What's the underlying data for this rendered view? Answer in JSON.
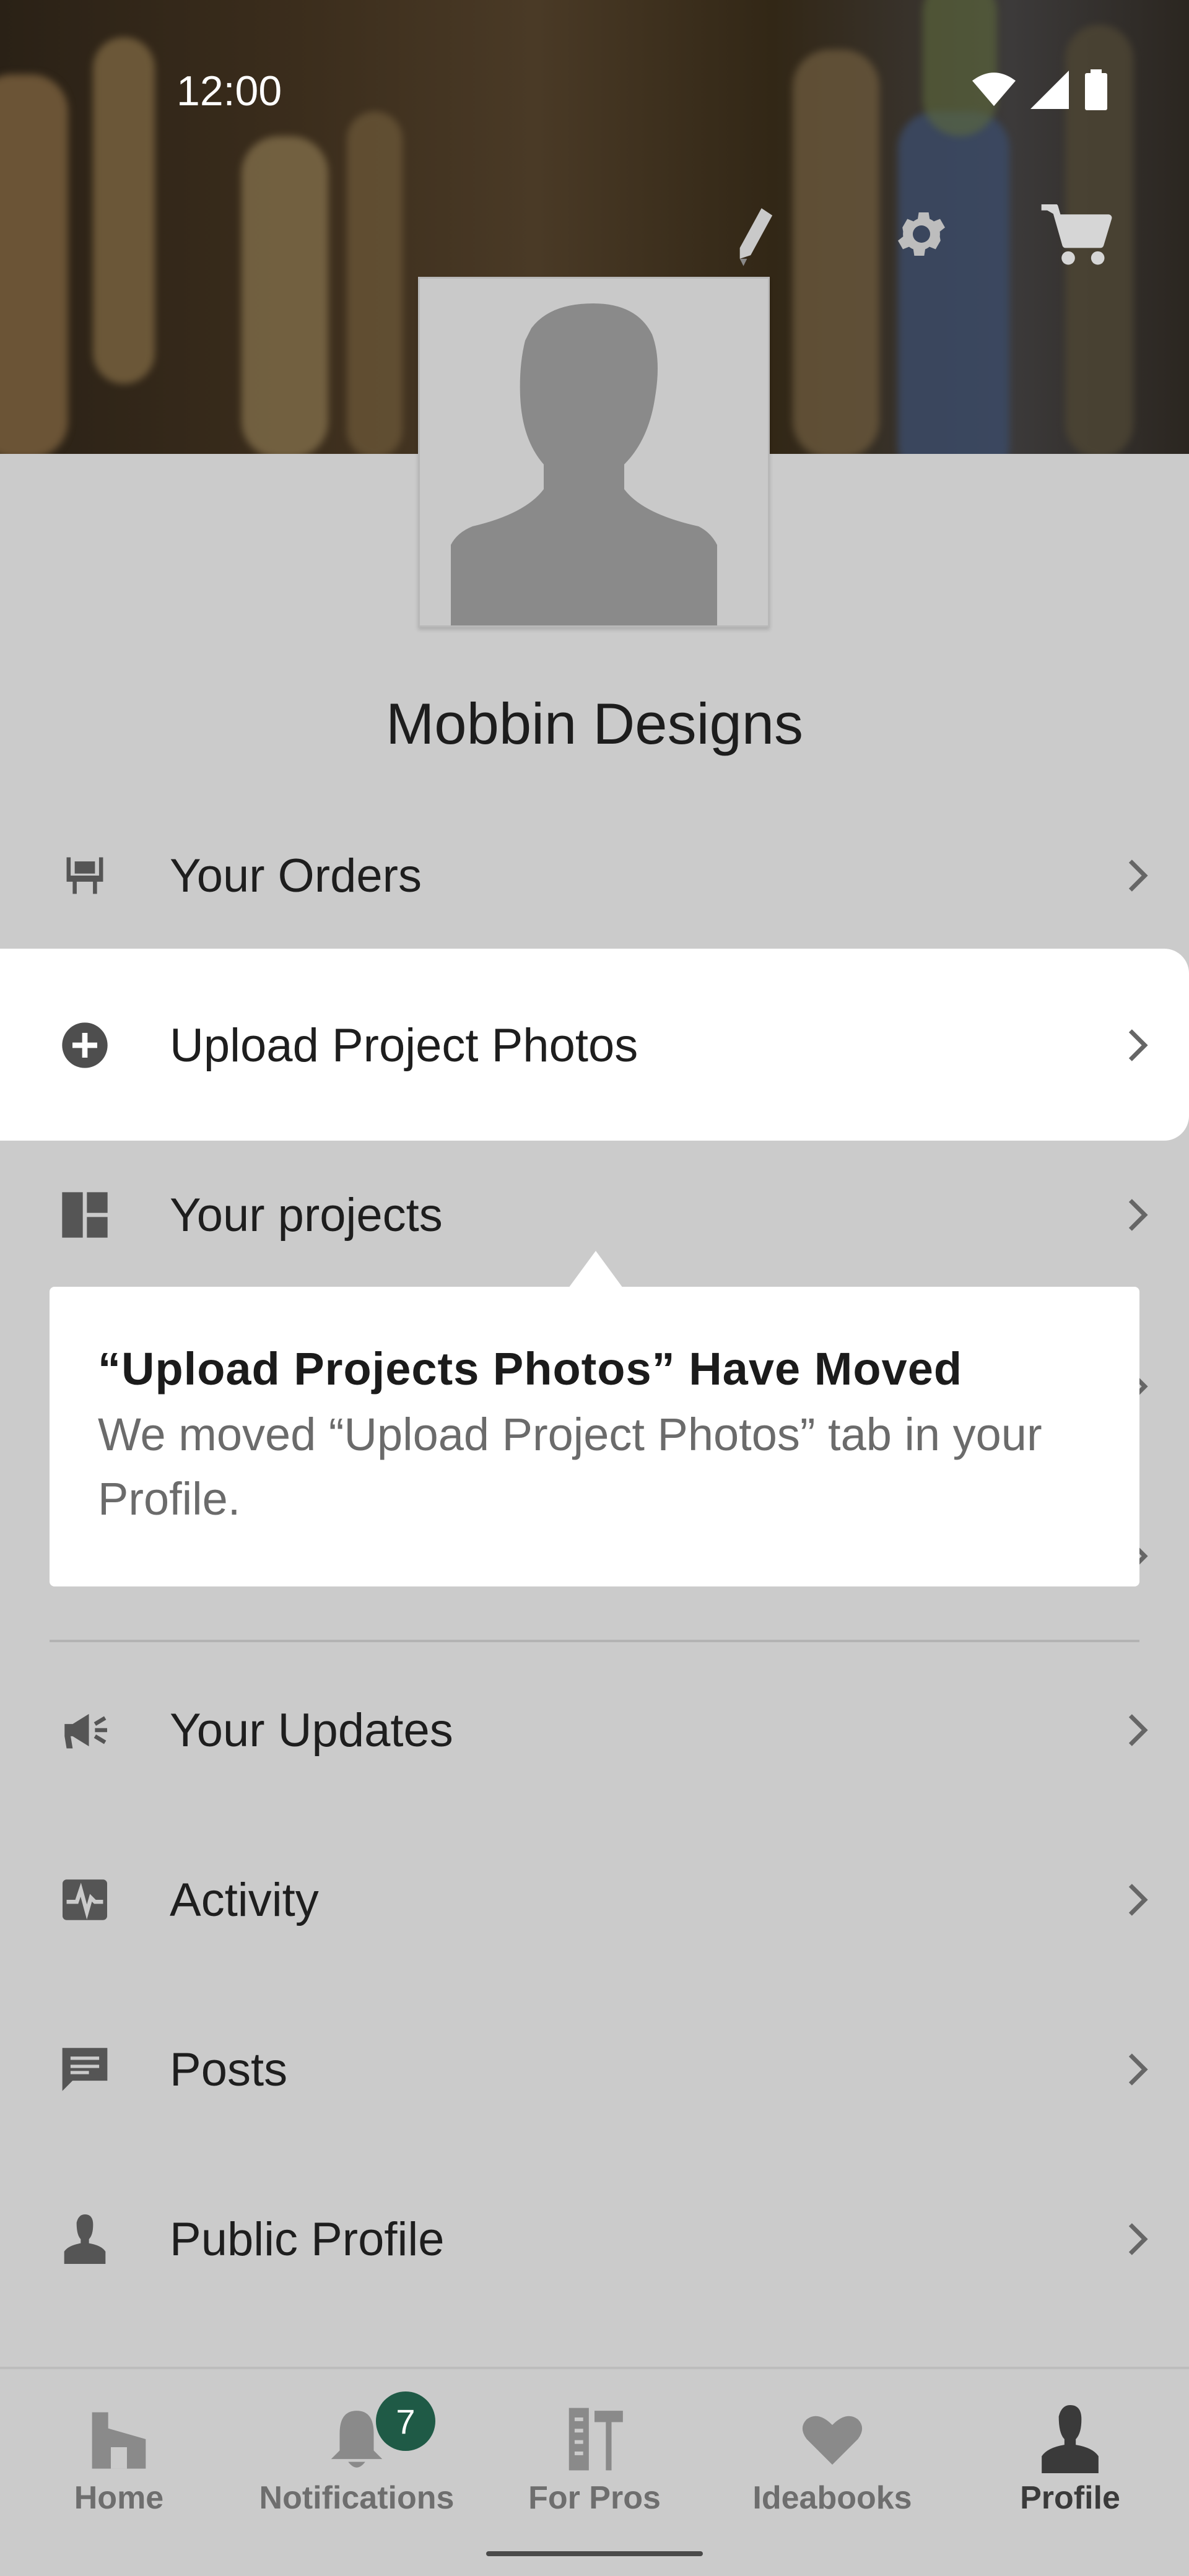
{
  "status_bar": {
    "time": "12:00"
  },
  "header": {
    "edit_icon": "pencil-icon",
    "settings_icon": "gear-icon",
    "cart_icon": "cart-icon"
  },
  "profile": {
    "name": "Mobbin Designs",
    "avatar_icon": "person-silhouette"
  },
  "menu": [
    {
      "label": "Your Orders",
      "icon": "armchair-icon"
    },
    {
      "label": "Upload Project Photos",
      "icon": "add-circle-icon"
    },
    {
      "label": "Your projects",
      "icon": "dashboard-icon"
    },
    {
      "label": "Your Updates",
      "icon": "megaphone-icon"
    },
    {
      "label": "Activity",
      "icon": "activity-icon"
    },
    {
      "label": "Posts",
      "icon": "chat-icon"
    },
    {
      "label": "Public Profile",
      "icon": "person-icon"
    }
  ],
  "tooltip": {
    "title": "“Upload Projects Photos” Have Moved",
    "body": "We moved “Upload Project Photos” tab in your Profile."
  },
  "bottom_nav": [
    {
      "label": "Home",
      "icon": "home-icon"
    },
    {
      "label": "Notifications",
      "icon": "bell-icon",
      "badge": "7"
    },
    {
      "label": "For Pros",
      "icon": "tools-icon"
    },
    {
      "label": "Ideabooks",
      "icon": "heart-icon"
    },
    {
      "label": "Profile",
      "icon": "person-icon",
      "active": true
    }
  ],
  "colors": {
    "accent": "#1f5a46",
    "background": "#cbcbcb"
  }
}
